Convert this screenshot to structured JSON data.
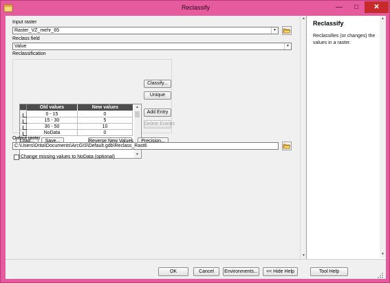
{
  "window": {
    "title": "Reclassify",
    "minimize_glyph": "—",
    "maximize_glyph": "□",
    "close_glyph": "✕"
  },
  "form": {
    "input_raster_label": "Input raster",
    "input_raster_value": "Raster_VZ_mehr_65",
    "reclass_field_label": "Reclass field",
    "reclass_field_value": "Value",
    "reclassification_label": "Reclassification",
    "table": {
      "headers": [
        "Old values",
        "New values"
      ],
      "rows": [
        {
          "old": "0 - 15",
          "new": "0"
        },
        {
          "old": "15 - 30",
          "new": "5"
        },
        {
          "old": "30 - 50",
          "new": "10"
        },
        {
          "old": "NoData",
          "new": "0"
        }
      ]
    },
    "side_buttons": {
      "classify": "Classify...",
      "unique": "Unique",
      "add_entry": "Add Entry",
      "delete_entries": "Delete Entries"
    },
    "bottom_buttons": {
      "load": "Load...",
      "save": "Save...",
      "reverse": "Reverse New Values",
      "precision": "Precision..."
    },
    "output_raster_label": "Output raster",
    "output_raster_value": "C:\\Users\\Drita\\Documents\\ArcGIS\\Default.gdb\\Reclass_Rast6",
    "missing_nodata_label": "Change missing values to NoData (optional)",
    "missing_nodata_checked": false
  },
  "help": {
    "title": "Reclassify",
    "text": "Reclassifies (or changes) the values in a raster."
  },
  "footer": {
    "ok": "OK",
    "cancel": "Cancel",
    "environments": "Environments...",
    "hide_help": "<< Hide Help",
    "tool_help": "Tool Help"
  },
  "colors": {
    "frame": "#e65a9e",
    "close_button": "#c62a2a",
    "grid_header": "#4d4d4d"
  },
  "icons": [
    "app-icon",
    "folder-open-icon",
    "chevron-down-icon",
    "scroll-up-arrow-icon",
    "scroll-down-arrow-icon",
    "resize-grip-icon"
  ]
}
